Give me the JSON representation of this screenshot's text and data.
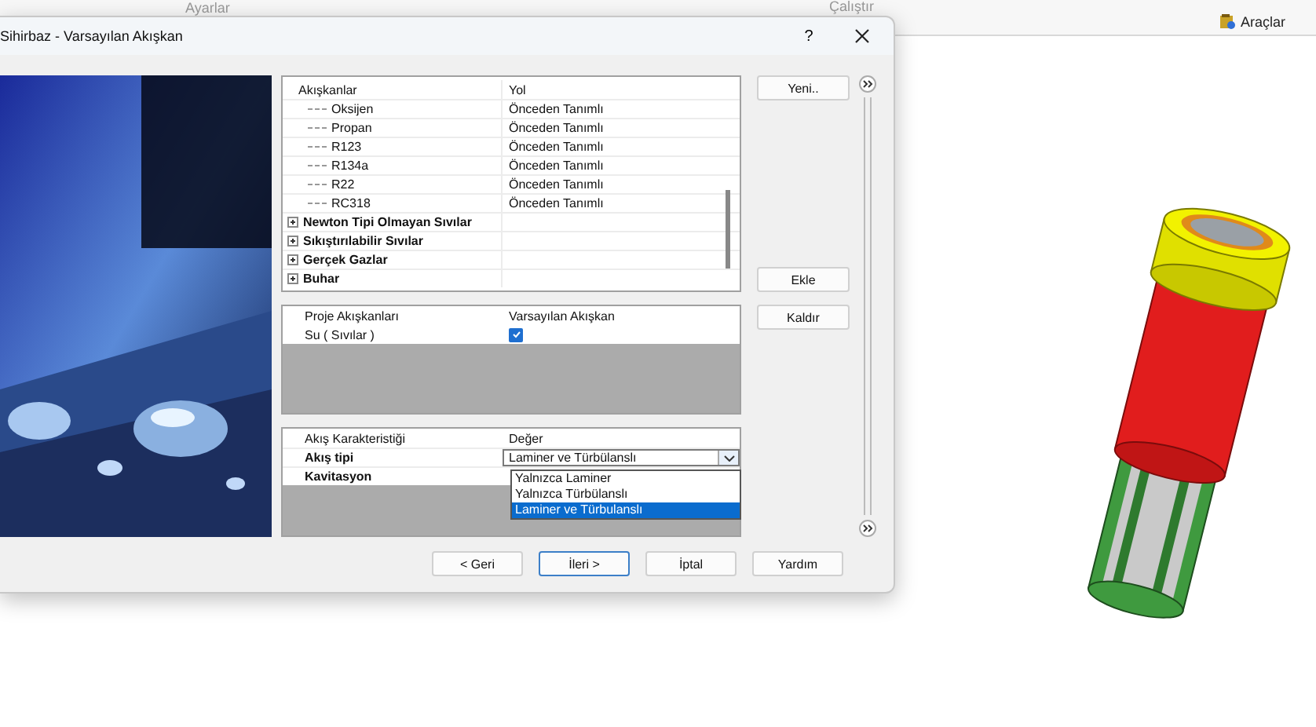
{
  "ribbon": {
    "group_labels": [
      "Ayarlar",
      "Çalıştır"
    ],
    "tools_button": "Araçlar"
  },
  "dialog": {
    "title": "Sihirbaz - Varsayılan Akışkan",
    "help": "?",
    "fluid_tree": {
      "columns": [
        "Akışkanlar",
        "Yol"
      ],
      "rows": [
        {
          "kind": "leaf",
          "name": "Oksijen",
          "path": "Önceden Tanımlı"
        },
        {
          "kind": "leaf",
          "name": "Propan",
          "path": "Önceden Tanımlı"
        },
        {
          "kind": "leaf",
          "name": "R123",
          "path": "Önceden Tanımlı"
        },
        {
          "kind": "leaf",
          "name": "R134a",
          "path": "Önceden Tanımlı"
        },
        {
          "kind": "leaf",
          "name": "R22",
          "path": "Önceden Tanımlı"
        },
        {
          "kind": "leaf",
          "name": "RC318",
          "path": "Önceden Tanımlı"
        },
        {
          "kind": "group",
          "name": "Newton Tipi Olmayan Sıvılar",
          "expanded": false
        },
        {
          "kind": "group",
          "name": "Sıkıştırılabilir Sıvılar",
          "expanded": false
        },
        {
          "kind": "group",
          "name": "Gerçek Gazlar",
          "expanded": false
        },
        {
          "kind": "group",
          "name": "Buhar",
          "expanded": false
        }
      ]
    },
    "project_fluids": {
      "columns": [
        "Proje Akışkanları",
        "Varsayılan Akışkan"
      ],
      "rows": [
        {
          "name": "Su ( Sıvılar )",
          "default": true
        }
      ]
    },
    "characteristics": {
      "columns": [
        "Akış Karakteristiği",
        "Değer"
      ],
      "rows": [
        {
          "name": "Akış tipi",
          "value": "Laminer ve Türbülanslı"
        },
        {
          "name": "Kavitasyon"
        }
      ],
      "dropdown_options": [
        {
          "label": "Yalnızca Laminer",
          "selected": false
        },
        {
          "label": "Yalnızca Türbülanslı",
          "selected": false
        },
        {
          "label": "Laminer ve Türbulanslı",
          "selected": true
        }
      ]
    },
    "side_buttons": [
      "Yeni..",
      "Ekle",
      "Kaldır"
    ],
    "nav_buttons": [
      {
        "label": "< Geri",
        "default": false
      },
      {
        "label": "İleri >",
        "default": true
      },
      {
        "label": "İptal",
        "default": false
      },
      {
        "label": "Yardım",
        "default": false
      }
    ]
  }
}
